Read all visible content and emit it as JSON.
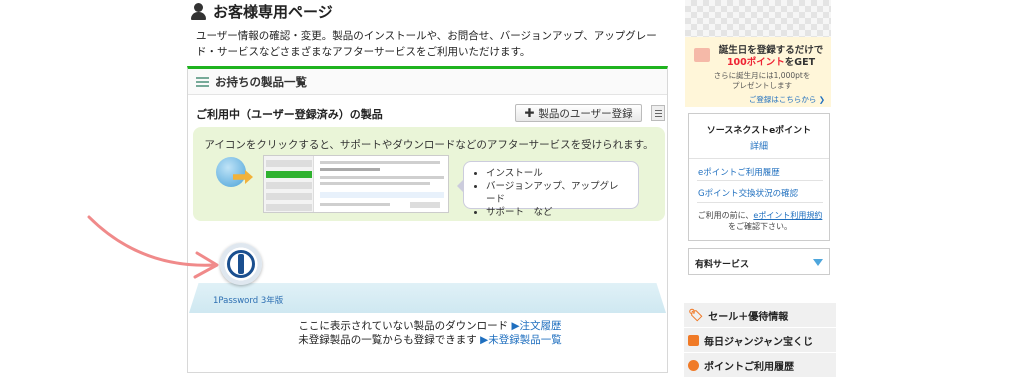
{
  "main": {
    "title": "お客様専用ページ",
    "intro": "ユーザー情報の確認・変更。製品のインストールや、お問合せ、バージョンアップ、アップグレード・サービスなどさまざまなアフターサービスをご利用いただけます。",
    "panel_title": "お持ちの製品一覧",
    "sub_title": "ご利用中（ユーザー登録済み）の製品",
    "register_button": "製品のユーザー登録",
    "info_text": "アイコンをクリックすると、サポートやダウンロードなどのアフターサービスを受けられます。",
    "bubble_items": [
      "インストール",
      "バージョンアップ、アップグレード",
      "サポート　など"
    ],
    "product_label": "1Password 3年版",
    "download_line": "ここに表示されていない製品のダウンロード",
    "download_link": "▶注文履歴",
    "unregistered_line": "未登録製品の一覧からも登録できます",
    "unregistered_link": "▶未登録製品一覧"
  },
  "right": {
    "bday_line1": "誕生日を登録するだけで",
    "bday_points": "100ポイント",
    "bday_get": "をGET",
    "bday_line2": "さらに誕生月には1,000ptを",
    "bday_line3": "プレゼントします",
    "bday_link": "ご登録はこちらから",
    "epoint_title": "ソースネクストeポイント",
    "epoint_detail": "詳細",
    "epoint_links": [
      "eポイントご利用履歴",
      "Gポイント交換状況の確認"
    ],
    "epoint_note_pre": "ご利用の前に、",
    "epoint_note_link": "eポイント利用規約",
    "epoint_note_post": "をご確認下さい。",
    "paid_services": "有料サービス",
    "nav": [
      "セール＋優待情報",
      "毎日ジャンジャン宝くじ",
      "ポイントご利用履歴"
    ]
  },
  "colors": {
    "accent_green": "#1eb31e",
    "link_blue": "#1f6fbf",
    "arrow_pink": "#f08a8a"
  }
}
